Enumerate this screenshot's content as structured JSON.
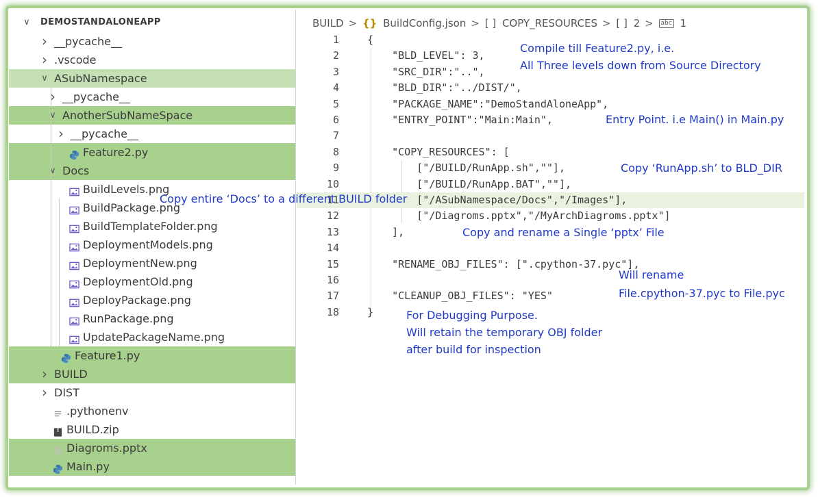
{
  "explorer": {
    "root_label": "DEMOSTANDALONEAPP",
    "items": [
      {
        "label": "__pycache__",
        "kind": "folder",
        "state": "collapsed",
        "depth": 1,
        "hl": "none"
      },
      {
        "label": ".vscode",
        "kind": "folder",
        "state": "collapsed",
        "depth": 1,
        "hl": "none"
      },
      {
        "label": "ASubNamespace",
        "kind": "folder",
        "state": "expanded",
        "depth": 1,
        "hl": "light"
      },
      {
        "label": "__pycache__",
        "kind": "folder",
        "state": "collapsed",
        "depth": 2,
        "hl": "none"
      },
      {
        "label": "AnotherSubNameSpace",
        "kind": "folder",
        "state": "expanded",
        "depth": 2,
        "hl": "dark"
      },
      {
        "label": "__pycache__",
        "kind": "folder",
        "state": "collapsed",
        "depth": 3,
        "hl": "none"
      },
      {
        "label": "Feature2.py",
        "kind": "python",
        "depth": 3,
        "hl": "dark"
      },
      {
        "label": "Docs",
        "kind": "folder",
        "state": "expanded",
        "depth": 2,
        "hl": "dark"
      },
      {
        "label": "BuildLevels.png",
        "kind": "image",
        "depth": 3,
        "hl": "none"
      },
      {
        "label": "BuildPackage.png",
        "kind": "image",
        "depth": 3,
        "hl": "none"
      },
      {
        "label": "BuildTemplateFolder.png",
        "kind": "image",
        "depth": 3,
        "hl": "none"
      },
      {
        "label": "DeploymentModels.png",
        "kind": "image",
        "depth": 3,
        "hl": "none"
      },
      {
        "label": "DeploymentNew.png",
        "kind": "image",
        "depth": 3,
        "hl": "none"
      },
      {
        "label": "DeploymentOld.png",
        "kind": "image",
        "depth": 3,
        "hl": "none"
      },
      {
        "label": "DeployPackage.png",
        "kind": "image",
        "depth": 3,
        "hl": "none"
      },
      {
        "label": "RunPackage.png",
        "kind": "image",
        "depth": 3,
        "hl": "none"
      },
      {
        "label": "UpdatePackageName.png",
        "kind": "image",
        "depth": 3,
        "hl": "none"
      },
      {
        "label": "Feature1.py",
        "kind": "python",
        "depth": 2,
        "hl": "dark"
      },
      {
        "label": "BUILD",
        "kind": "folder",
        "state": "collapsed",
        "depth": 1,
        "hl": "dark"
      },
      {
        "label": "DIST",
        "kind": "folder",
        "state": "collapsed",
        "depth": 1,
        "hl": "none"
      },
      {
        "label": ".pythonenv",
        "kind": "env",
        "depth": 1,
        "hl": "none"
      },
      {
        "label": "BUILD.zip",
        "kind": "zip",
        "depth": 1,
        "hl": "none"
      },
      {
        "label": "Diagroms.pptx",
        "kind": "pptx",
        "depth": 1,
        "hl": "dark"
      },
      {
        "label": "Main.py",
        "kind": "python",
        "depth": 1,
        "hl": "dark"
      }
    ]
  },
  "breadcrumb": {
    "folder": "BUILD",
    "json_icon": "{}",
    "file": "BuildConfig.json",
    "array_icon": "[ ]",
    "key": "COPY_RESOURCES",
    "array_icon2": "[ ]",
    "index": "2",
    "string_icon": "abc",
    "sub_index": "1"
  },
  "code_lines": [
    {
      "n": "1",
      "text": "{"
    },
    {
      "n": "2",
      "text": "    \"BLD_LEVEL\": 3,"
    },
    {
      "n": "3",
      "text": "    \"SRC_DIR\":\"..\","
    },
    {
      "n": "4",
      "text": "    \"BLD_DIR\":\"../DIST/\","
    },
    {
      "n": "5",
      "text": "    \"PACKAGE_NAME\":\"DemoStandAloneApp\","
    },
    {
      "n": "6",
      "text": "    \"ENTRY_POINT\":\"Main:Main\","
    },
    {
      "n": "7",
      "text": ""
    },
    {
      "n": "8",
      "text": "    \"COPY_RESOURCES\": ["
    },
    {
      "n": "9",
      "text": "        [\"/BUILD/RunApp.sh\",\"\"],"
    },
    {
      "n": "10",
      "text": "        [\"/BUILD/RunApp.BAT\",\"\"],"
    },
    {
      "n": "11",
      "text": "        [\"/ASubNamespace/Docs\",\"/Images\"],"
    },
    {
      "n": "12",
      "text": "        [\"/Diagroms.pptx\",\"/MyArchDiagroms.pptx\"]"
    },
    {
      "n": "13",
      "text": "    ],"
    },
    {
      "n": "14",
      "text": ""
    },
    {
      "n": "15",
      "text": "    \"RENAME_OBJ_FILES\": [\".cpython-37.pyc\"],"
    },
    {
      "n": "16",
      "text": ""
    },
    {
      "n": "17",
      "text": "    \"CLEANUP_OBJ_FILES\": \"YES\""
    },
    {
      "n": "18",
      "text": "}"
    }
  ],
  "annotations": {
    "bld_level_1": "Compile till Feature2.py, i.e.",
    "bld_level_2": "All Three levels down from Source Directory",
    "entry_point": "Entry Point. i.e Main() in Main.py",
    "runapp": "Copy ‘RunApp.sh’  to BLD_DIR",
    "docs": "Copy entire ‘Docs’  to a different  BUILD folder",
    "pptx": "Copy and rename a Single ‘pptx’ File",
    "rename_1": "Will rename",
    "rename_2": "File.cpython-37.pyc to File.pyc",
    "debug_1": "For Debugging Purpose.",
    "debug_2": "Will retain the temporary OBJ folder",
    "debug_3": "after build for inspection"
  },
  "colors": {
    "highlight_dark": "#a9d18e",
    "highlight_light": "#c5e0b4",
    "annotation": "#1f39c8",
    "python_icon": "#3776ab",
    "frame_border": "#a9d18e"
  }
}
